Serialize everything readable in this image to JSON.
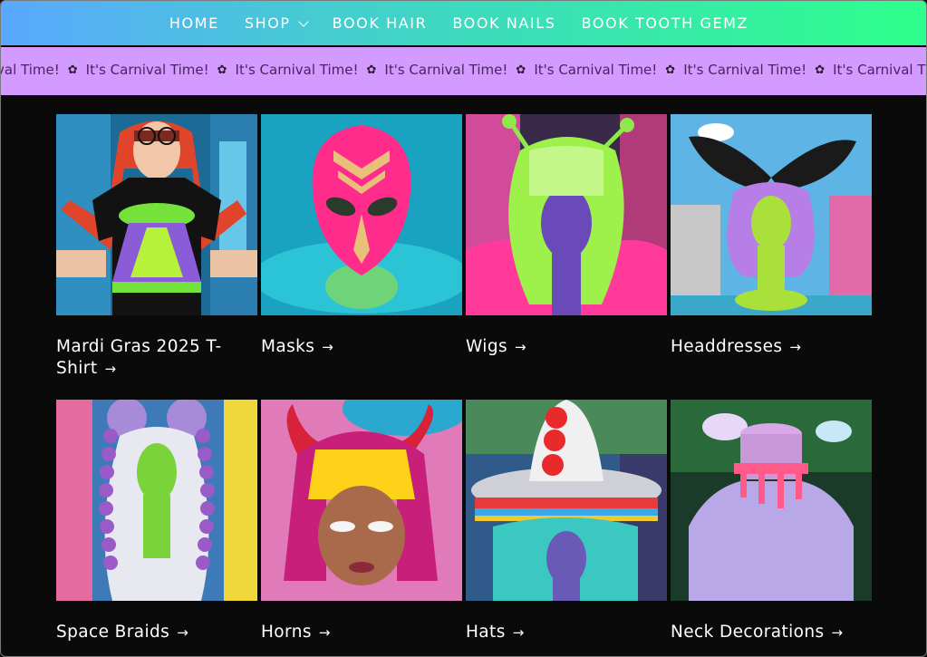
{
  "nav": {
    "items": [
      {
        "label": "HOME"
      },
      {
        "label": "SHOP"
      },
      {
        "label": "BOOK HAIR"
      },
      {
        "label": "BOOK NAILS"
      },
      {
        "label": "BOOK TOOTH GEMZ"
      }
    ]
  },
  "marquee": {
    "partial_first": "val Time!",
    "text": "It's Carnival Time!",
    "partial_last": "It's Carnival Tim",
    "separator_icon": "flower-icon"
  },
  "collections": [
    {
      "title": "Mardi Gras 2025 T-Shirt",
      "image": "mardi-gras-tshirt-photo"
    },
    {
      "title": "Masks",
      "image": "pink-alien-mask-photo"
    },
    {
      "title": "Wigs",
      "image": "green-alien-wig-photo"
    },
    {
      "title": "Headdresses",
      "image": "butterfly-headdress-photo"
    },
    {
      "title": "Space Braids",
      "image": "space-braids-photo"
    },
    {
      "title": "Horns",
      "image": "red-horns-photo"
    },
    {
      "title": "Hats",
      "image": "carnival-hat-photo"
    },
    {
      "title": "Neck Decorations",
      "image": "drip-choker-photo"
    }
  ],
  "colors": {
    "nav_gradient_start": "#5aa8ff",
    "nav_gradient_end": "#2eff8a",
    "marquee_bg": "#d39aff",
    "marquee_text": "#4a2460",
    "page_bg": "#0a0a0a",
    "title_text": "#ffffff"
  }
}
